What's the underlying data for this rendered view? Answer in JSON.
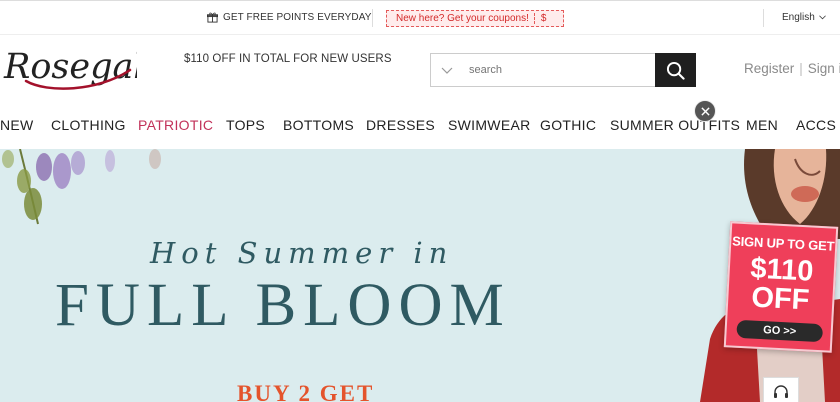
{
  "topbar": {
    "points_text": "GET FREE POINTS EVERYDAY",
    "coupon_text": "New here? Get your coupons!",
    "coupon_symbol": "$",
    "language": "English"
  },
  "header": {
    "logo_text": "Rosegal",
    "promo_text": "$110 OFF IN TOTAL FOR NEW USERS",
    "search_placeholder": "search",
    "register_label": "Register",
    "separator": "|",
    "signin_label": "Sign in"
  },
  "nav": {
    "items": [
      {
        "label": "NEW"
      },
      {
        "label": "CLOTHING"
      },
      {
        "label": "PATRIOTIC"
      },
      {
        "label": "TOPS"
      },
      {
        "label": "BOTTOMS"
      },
      {
        "label": "DRESSES"
      },
      {
        "label": "SWIMWEAR"
      },
      {
        "label": "GOTHIC"
      },
      {
        "label": "SUMMER OUTFITS"
      },
      {
        "label": "MEN"
      },
      {
        "label": "ACCS"
      }
    ],
    "accent_color": "#c2325a"
  },
  "hero": {
    "script_text": "Hot Summer in",
    "headline": "FULL BLOOM",
    "offer_text": "BUY 2 GET",
    "background": "#dbecee",
    "text_color": "#2f5a62",
    "offer_color": "#e4542c"
  },
  "signup_popup": {
    "line1": "SIGN UP TO GET",
    "amount": "$110",
    "off": "OFF",
    "button_label": "GO >>",
    "color": "#ef3f5a"
  },
  "icons": {
    "gift": "gift-icon",
    "chevron": "chevron-down-icon",
    "search": "search-icon",
    "close": "close-icon",
    "support": "headset-icon"
  }
}
